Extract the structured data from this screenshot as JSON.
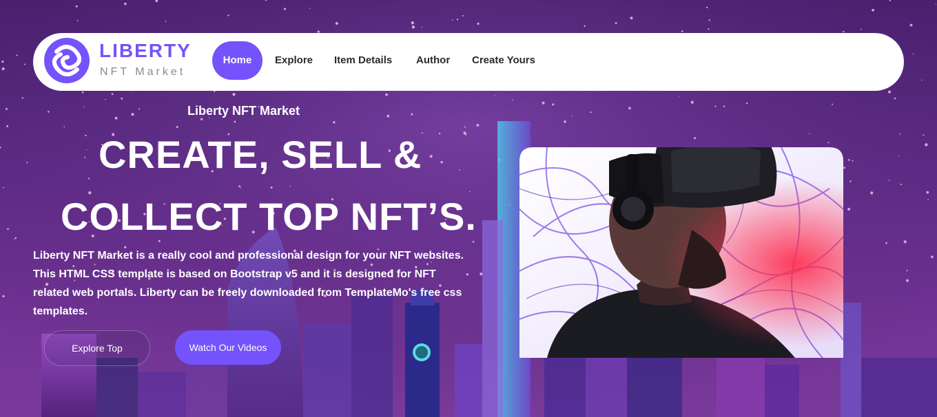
{
  "brand": {
    "name": "LIBERTY",
    "tagline": "NFT Market"
  },
  "nav": {
    "items": [
      {
        "label": "Home",
        "active": true
      },
      {
        "label": "Explore"
      },
      {
        "label": "Item Details"
      },
      {
        "label": "Author"
      },
      {
        "label": "Create Yours"
      }
    ]
  },
  "hero": {
    "kicker": "Liberty NFT Market",
    "headline_line1": "CREATE, SELL &",
    "headline_line2": "COLLECT TOP NFT’S.",
    "description": "Liberty NFT Market is a really cool and professional design for your NFT websites. This HTML CSS template is based on Bootstrap v5 and it is designed for NFT related web portals. Liberty can be freely downloaded from TemplateMo's free css templates.",
    "buttons": {
      "explore": "Explore Top",
      "videos": "Watch Our Videos"
    }
  },
  "colors": {
    "accent": "#7453fc",
    "nav_bg": "#ffffff",
    "text_light": "#ffffff",
    "text_dark": "#2a2a2a"
  },
  "icons": {
    "logo": "liberty-logo-icon"
  }
}
